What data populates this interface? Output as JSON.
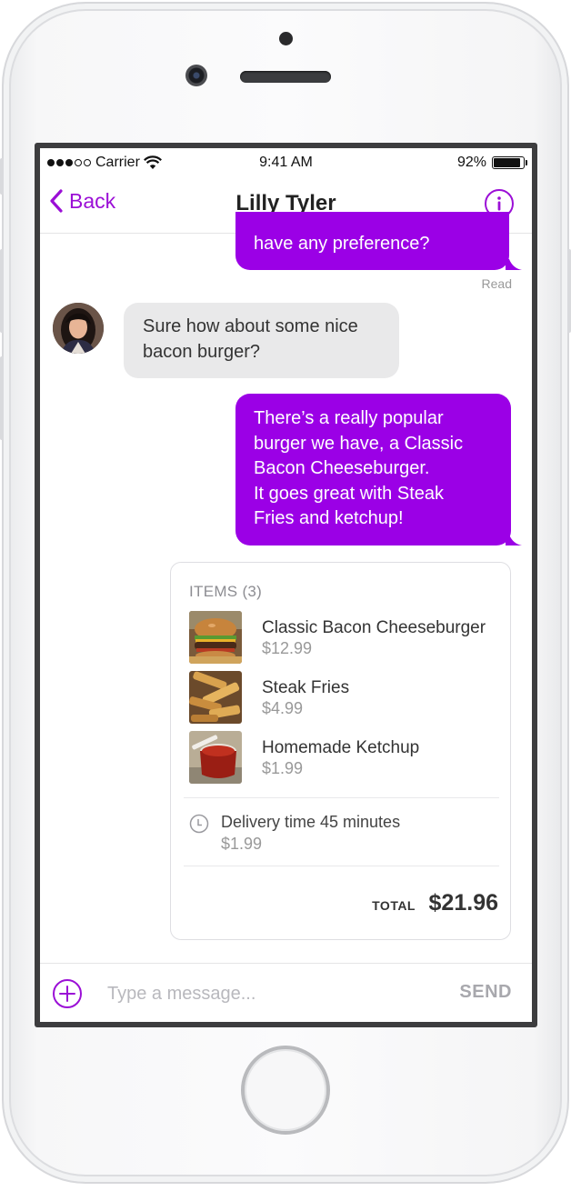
{
  "status_bar": {
    "carrier": "Carrier",
    "time": "9:41 AM",
    "battery": "92%",
    "battery_level": 0.92,
    "signal_bars": 3,
    "signal_total": 5
  },
  "nav": {
    "back_label": "Back",
    "title": "Lilly Tyler",
    "info_icon": "info-icon",
    "accent_color": "#9B0FD6"
  },
  "conversation": {
    "partial_message": "have any preference?",
    "read_label": "Read",
    "incoming_message": [
      "Sure how about some nice",
      "bacon burger?"
    ],
    "outgoing_message": [
      "There’s a really popular",
      "burger we have, a Classic",
      "Bacon Cheeseburger.",
      "It goes great with Steak",
      "Fries and ketchup!"
    ],
    "bubble_out_color": "#9B00E6",
    "bubble_in_color": "#E9E9EA"
  },
  "order": {
    "items_header": "ITEMS (3)",
    "items": [
      {
        "name": "Classic Bacon Cheeseburger",
        "price": "$12.99",
        "thumb": "burger-image"
      },
      {
        "name": "Steak Fries",
        "price": "$4.99",
        "thumb": "fries-image"
      },
      {
        "name": "Homemade Ketchup",
        "price": "$1.99",
        "thumb": "ketchup-image"
      }
    ],
    "delivery_text": "Delivery time 45 minutes",
    "delivery_price": "$1.99",
    "total_label": "TOTAL",
    "total_value": "$21.96"
  },
  "composer": {
    "placeholder": "Type a message...",
    "send_label": "SEND",
    "add_icon": "plus-circle-icon"
  }
}
